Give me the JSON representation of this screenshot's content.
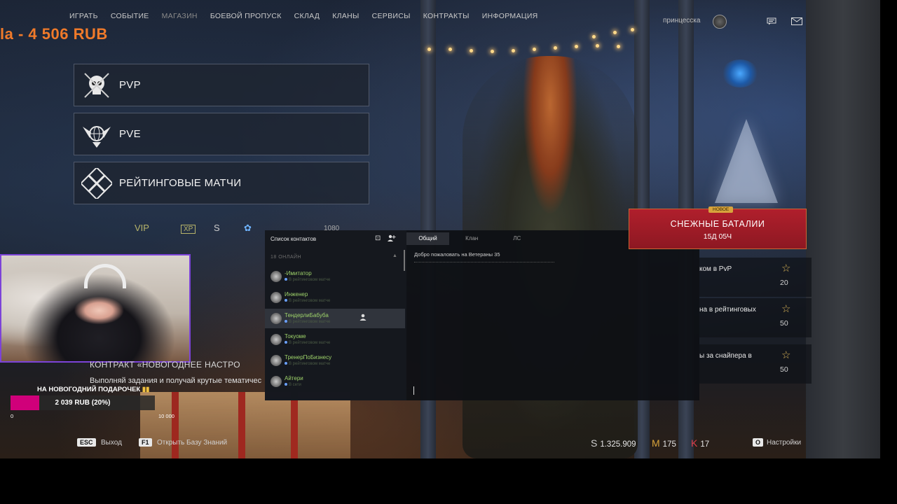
{
  "nav": {
    "items": [
      "ИГРАТЬ",
      "СОБЫТИЕ",
      "МАГАЗИН",
      "БОЕВОЙ ПРОПУСК",
      "СКЛАД",
      "КЛАНЫ",
      "СЕРВИСЫ",
      "КОНТРАКТЫ",
      "ИНФОРМАЦИЯ"
    ]
  },
  "promo_text": "la - 4 506 RUB",
  "user": {
    "name": "принцесска"
  },
  "modes": [
    "PVP",
    "PVE",
    "РЕЙТИНГОВЫЕ МАТЧИ"
  ],
  "stats_row": {
    "vip": "VIP",
    "xp": "XP",
    "s": "S",
    "count": "1080"
  },
  "contacts": {
    "title": "Список контактов",
    "online_header": "18 ОНЛАЙН",
    "status_text": "В рейтинговом матче",
    "items": [
      {
        "name": "-Имитатор"
      },
      {
        "name": "Инженер"
      },
      {
        "name": "ТендерлиБабуба"
      },
      {
        "name": "Токуоме"
      },
      {
        "name": "ТренерПоБизнесу"
      },
      {
        "name": "Айтери",
        "status": "В сети"
      }
    ]
  },
  "chat": {
    "tabs": [
      "Общий",
      "Клан",
      "ЛС"
    ],
    "welcome": "Добро пожаловать на Ветераны 35"
  },
  "event": {
    "badge": "НОВОЕ",
    "title": "СНЕЖНЫЕ БАТАЛИИ",
    "time": "15Д 05Ч"
  },
  "challenges": [
    {
      "text": "ком в PvP",
      "reward": "20"
    },
    {
      "text": "на в рейтинговых",
      "reward": "50"
    },
    {
      "text": "ы за снайпера в",
      "reward": "50"
    }
  ],
  "contract": {
    "title": "КОНТРАКТ «НОВОГОДНЕЕ НАСТРО",
    "desc": "Выполняй задания и получай крутые тематичес"
  },
  "donation": {
    "label": "НА НОВОГОДНИЙ ПОДАРОЧЕК",
    "amount_text": "2 039 RUB (20%)",
    "progress": 0.2,
    "min": "0",
    "max": "10 000"
  },
  "bottom": {
    "esc_key": "ESC",
    "esc_label": "Выход",
    "f1_key": "F1",
    "f1_label": "Открыть Базу Знаний",
    "o_key": "O",
    "o_label": "Настройки"
  },
  "currencies": {
    "s_symbol": "S",
    "s_value": "1.325.909",
    "m_symbol": "M",
    "m_value": "175",
    "k_symbol": "K",
    "k_value": "17"
  },
  "colors": {
    "accent_purple": "#7c43d8",
    "donation_pink": "#d0007a",
    "event_red": "#b01f2c",
    "promo_orange": "#f07a2a",
    "online_green": "#9ed36a"
  }
}
